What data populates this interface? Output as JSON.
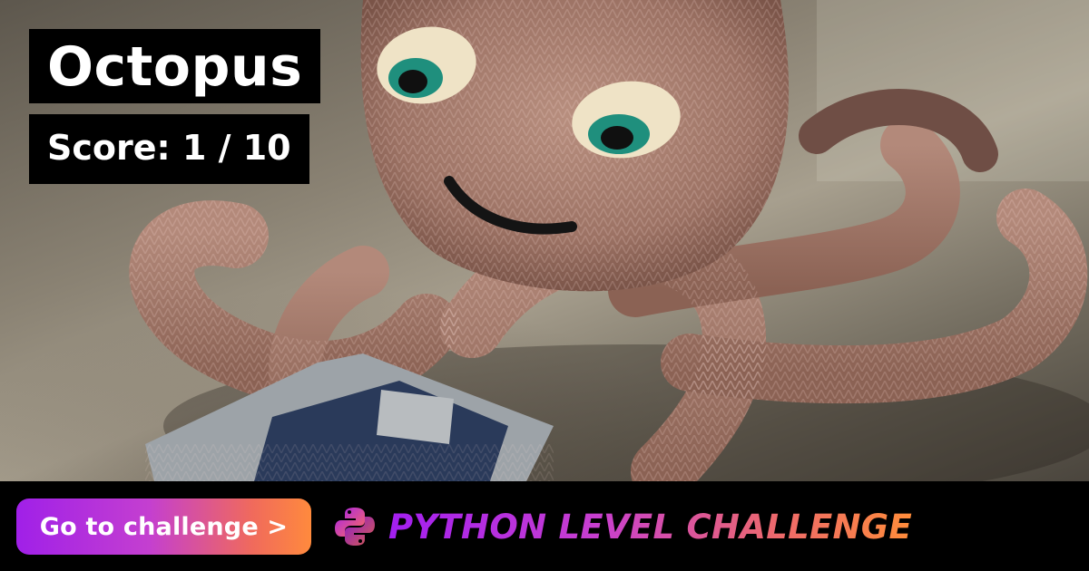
{
  "hero": {
    "icon": "knitted-octopus-photo"
  },
  "header": {
    "title": "Octopus",
    "score": "Score: 1 / 10"
  },
  "footer": {
    "cta_label": "Go to challenge >",
    "brand_text": "PYTHON LEVEL CHALLENGE",
    "brand_icon": "python-logo-icon"
  },
  "colors": {
    "gradient_start": "#a020e8",
    "gradient_mid": "#c43fd0",
    "gradient_end": "#ff8a3d",
    "background": "#000000",
    "text": "#ffffff"
  }
}
